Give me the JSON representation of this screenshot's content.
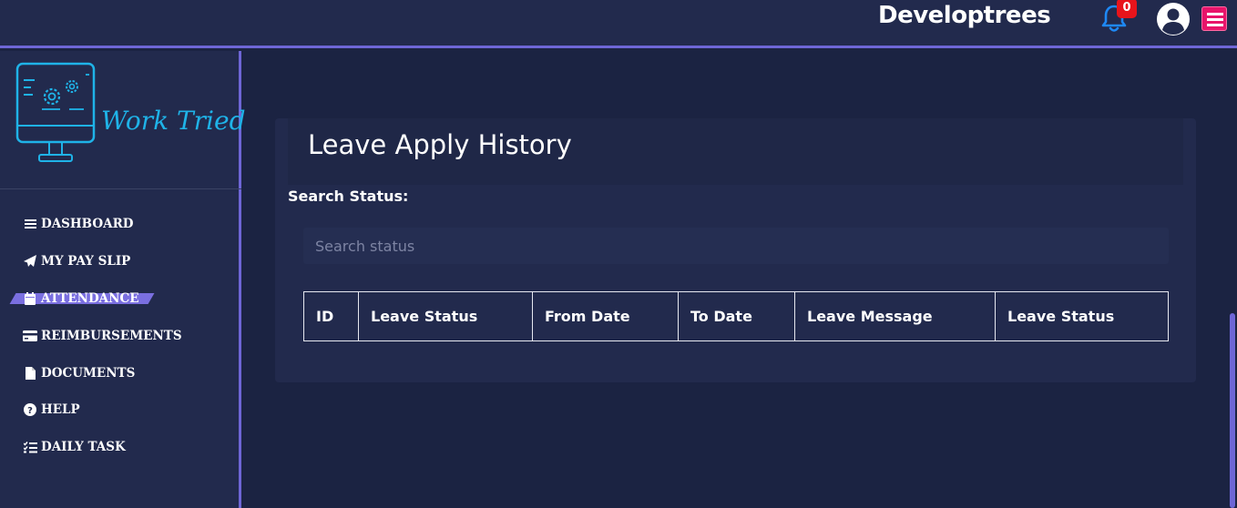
{
  "header": {
    "brand": "Developtrees",
    "notification_count": "0",
    "icons": {
      "bell": "bell-icon",
      "user": "user-circle-icon",
      "menu": "hamburger-icon"
    },
    "colors": {
      "accent": "#6e66d6",
      "bell": "#1e88f5",
      "badge": "#e8141b",
      "menu": "#e8146a"
    }
  },
  "sidebar": {
    "logo_text": "Work Tried",
    "items": [
      {
        "label": "DASHBOARD",
        "icon": "list-icon",
        "active": false
      },
      {
        "label": "MY PAY SLIP",
        "icon": "paper-plane-icon",
        "active": false
      },
      {
        "label": "ATTENDANCE",
        "icon": "calendar-icon",
        "active": true
      },
      {
        "label": "REIMBURSEMENTS",
        "icon": "credit-card-icon",
        "active": false
      },
      {
        "label": "DOCUMENTS",
        "icon": "file-icon",
        "active": false
      },
      {
        "label": "HELP",
        "icon": "question-circle-icon",
        "active": false
      },
      {
        "label": "DAILY TASK",
        "icon": "task-list-icon",
        "active": false
      }
    ]
  },
  "main": {
    "title": "Leave Apply History",
    "search_label": "Search Status:",
    "search_placeholder": "Search status",
    "search_value": "",
    "table": {
      "columns": [
        "ID",
        "Leave Status",
        "From Date",
        "To Date",
        "Leave Message",
        "Leave Status"
      ],
      "rows": []
    }
  }
}
